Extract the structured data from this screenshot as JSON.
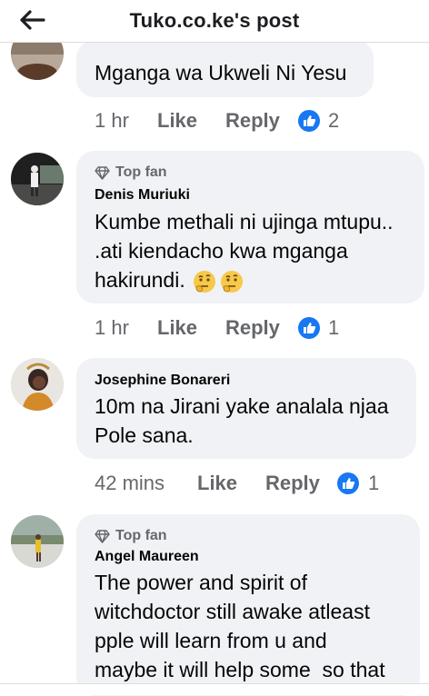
{
  "header": {
    "title": "Tuko.co.ke's post",
    "back_icon": "arrow-left-icon"
  },
  "comments": [
    {
      "badge": "",
      "author": "",
      "text": "Mganga wa Ukweli Ni Yesu",
      "time": "1 hr",
      "like": "Like",
      "reply": "Reply",
      "reactions": "2"
    },
    {
      "badge": "Top fan",
      "author": "Denis Muriuki",
      "text": "Kumbe methali ni ujinga mtupu..\n.ati kiendacho kwa mganga\nhakirundi.",
      "time": "1 hr",
      "like": "Like",
      "reply": "Reply",
      "reactions": "1"
    },
    {
      "badge": "",
      "author": "Josephine Bonareri",
      "text": "10m na Jirani yake analala njaa\nPole sana.",
      "time": "42 mins",
      "like": "Like",
      "reply": "Reply",
      "reactions": "1"
    },
    {
      "badge": "Top fan",
      "author": "Angel Maureen",
      "text": "The power and spirit of\nwitchdoctor still awake atleast\npple will learn from u and\nmaybe it will help some  so that",
      "time": "",
      "like": "",
      "reply": "",
      "reactions": ""
    }
  ],
  "colors": {
    "like_blue": "#1877f2",
    "bubble": "#f0f2f5",
    "meta": "#65676b"
  }
}
